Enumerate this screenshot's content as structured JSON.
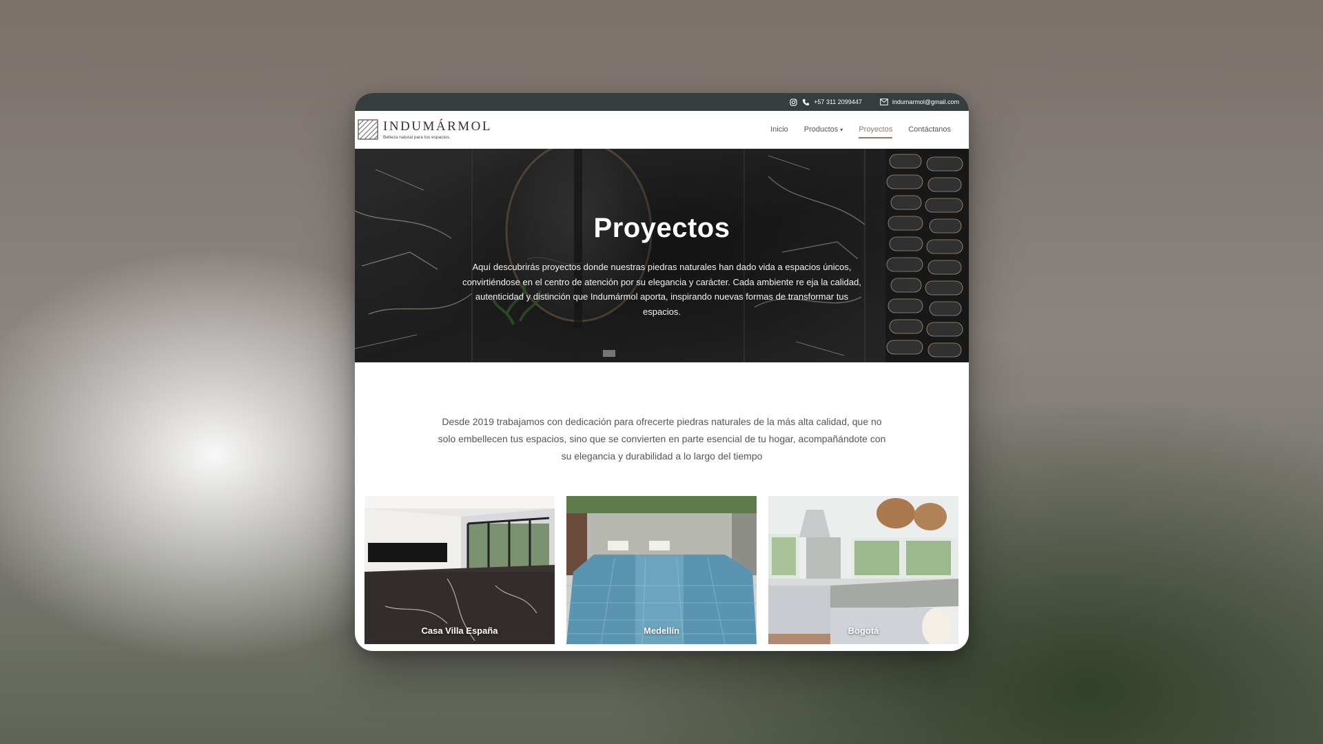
{
  "topbar": {
    "phone": "+57 311 2099447",
    "email": "indumarmol@gmail.com",
    "icons": [
      "instagram-icon",
      "phone-icon",
      "mail-icon"
    ]
  },
  "brand": {
    "name": "INDUMÁRMOL",
    "tagline": "Belleza natural para tus espacios."
  },
  "nav": {
    "items": [
      {
        "label": "Inicio"
      },
      {
        "label": "Productos",
        "caret": "▾"
      },
      {
        "label": "Proyectos"
      },
      {
        "label": "Contáctanos"
      }
    ],
    "active": "Proyectos"
  },
  "hero": {
    "title": "Proyectos",
    "text": "Aquí descubrirás proyectos donde nuestras piedras naturales han dado vida a espacios únicos, convirtiéndose en el centro de atención por su elegancia y carácter. Cada ambiente re eja la calidad, autenticidad y distinción que Indumármol aporta, inspirando nuevas formas de transformar tus espacios."
  },
  "intro": {
    "text": "Desde 2019 trabajamos con dedicación para ofrecerte piedras naturales de la más alta calidad, que no solo embellecen tus espacios, sino que se convierten en parte esencial de tu hogar, acompañándote con su elegancia y durabilidad a lo largo del tiempo"
  },
  "projects": [
    {
      "label": "Casa Villa España"
    },
    {
      "label": "Medellín"
    },
    {
      "label": "Bogotá"
    }
  ],
  "colors": {
    "topbar": "#363d3e",
    "accent": "#9c7a5e",
    "text": "#555555"
  }
}
